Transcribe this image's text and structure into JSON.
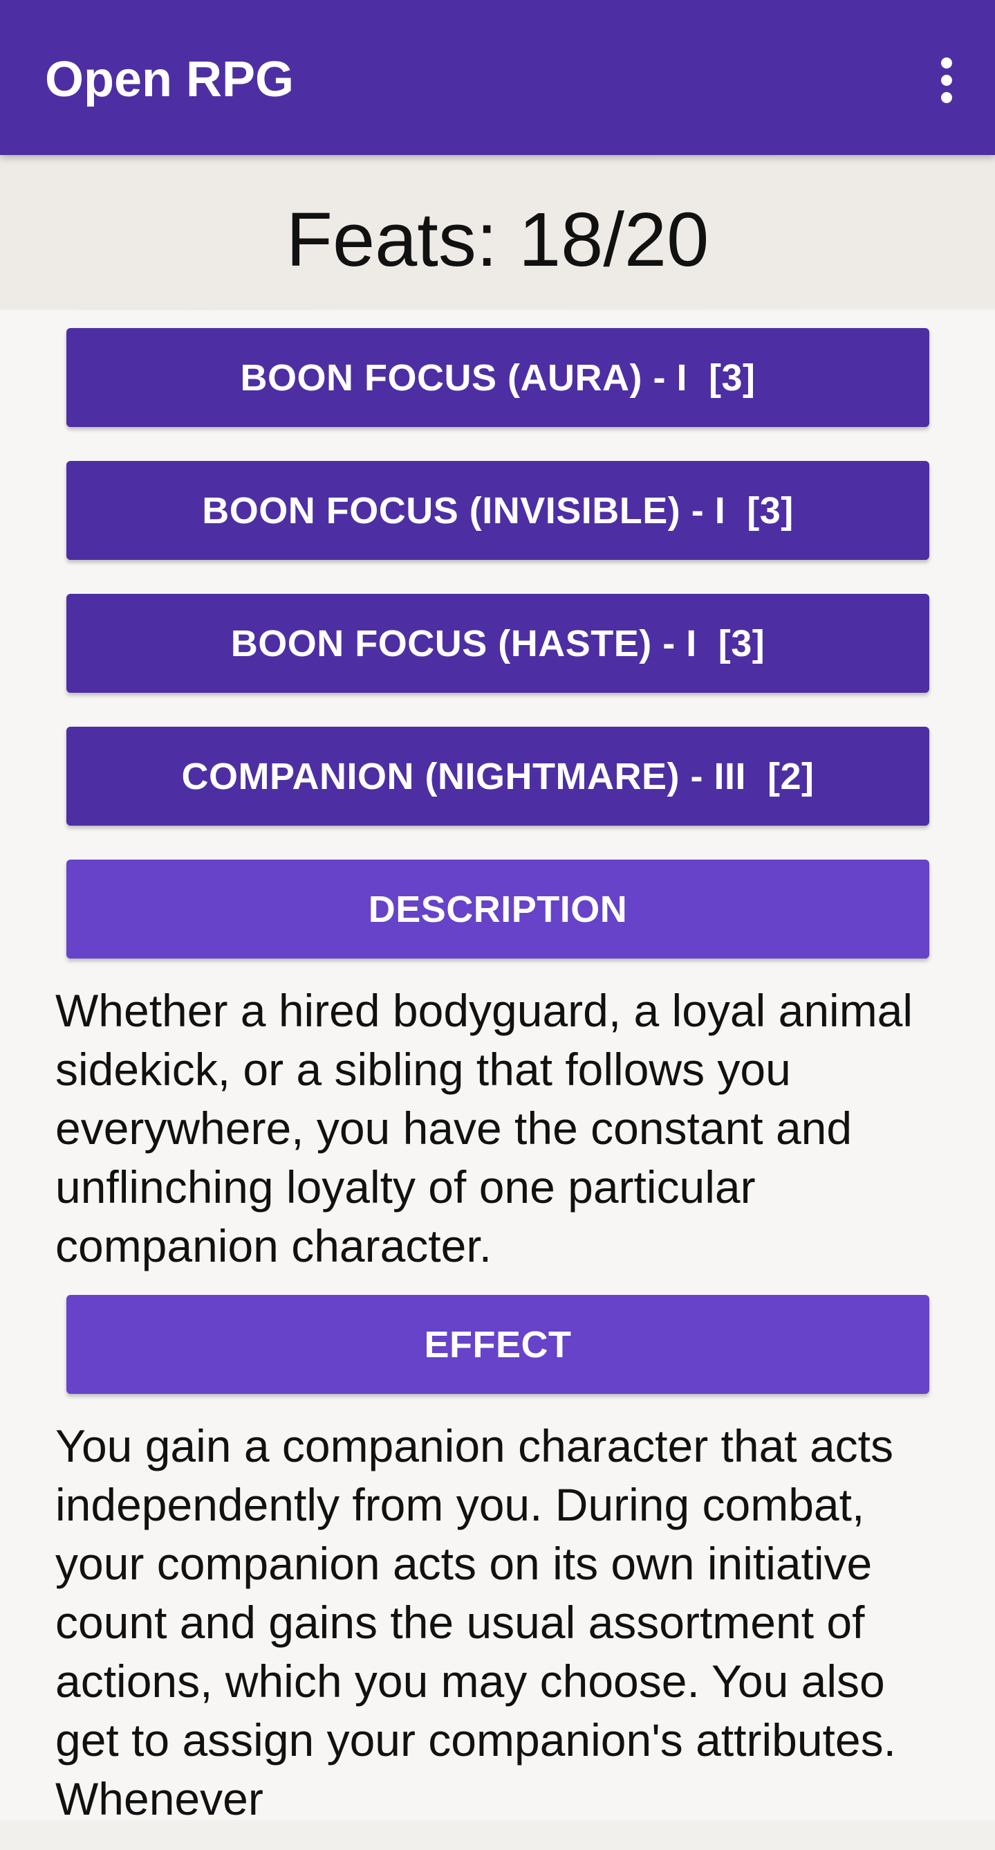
{
  "app_bar": {
    "title": "Open RPG",
    "overflow_icon": "more-vert-icon"
  },
  "feats": {
    "title": "Feats: 18/20"
  },
  "feat_buttons": [
    {
      "label": "BOON FOCUS (AURA) - I  [3]"
    },
    {
      "label": "BOON FOCUS (INVISIBLE) - I  [3]"
    },
    {
      "label": "BOON FOCUS (HASTE) - I  [3]"
    },
    {
      "label": "COMPANION (NIGHTMARE) - III  [2]"
    }
  ],
  "description": {
    "button_label": "DESCRIPTION",
    "text": "Whether a hired bodyguard, a loyal animal sidekick, or a sibling that follows you everywhere, you have the constant and unflinching loyalty of one particular companion character."
  },
  "effect": {
    "button_label": "EFFECT",
    "text": "You gain a companion character that acts independently from you. During combat, your companion acts on its own initiative count and gains the usual assortment of actions, which you may choose. You also get to assign your companion's attributes. Whenever"
  },
  "colors": {
    "primary": "#4d2fa3",
    "accent": "#6643c8",
    "background": "#f2f0ec"
  }
}
